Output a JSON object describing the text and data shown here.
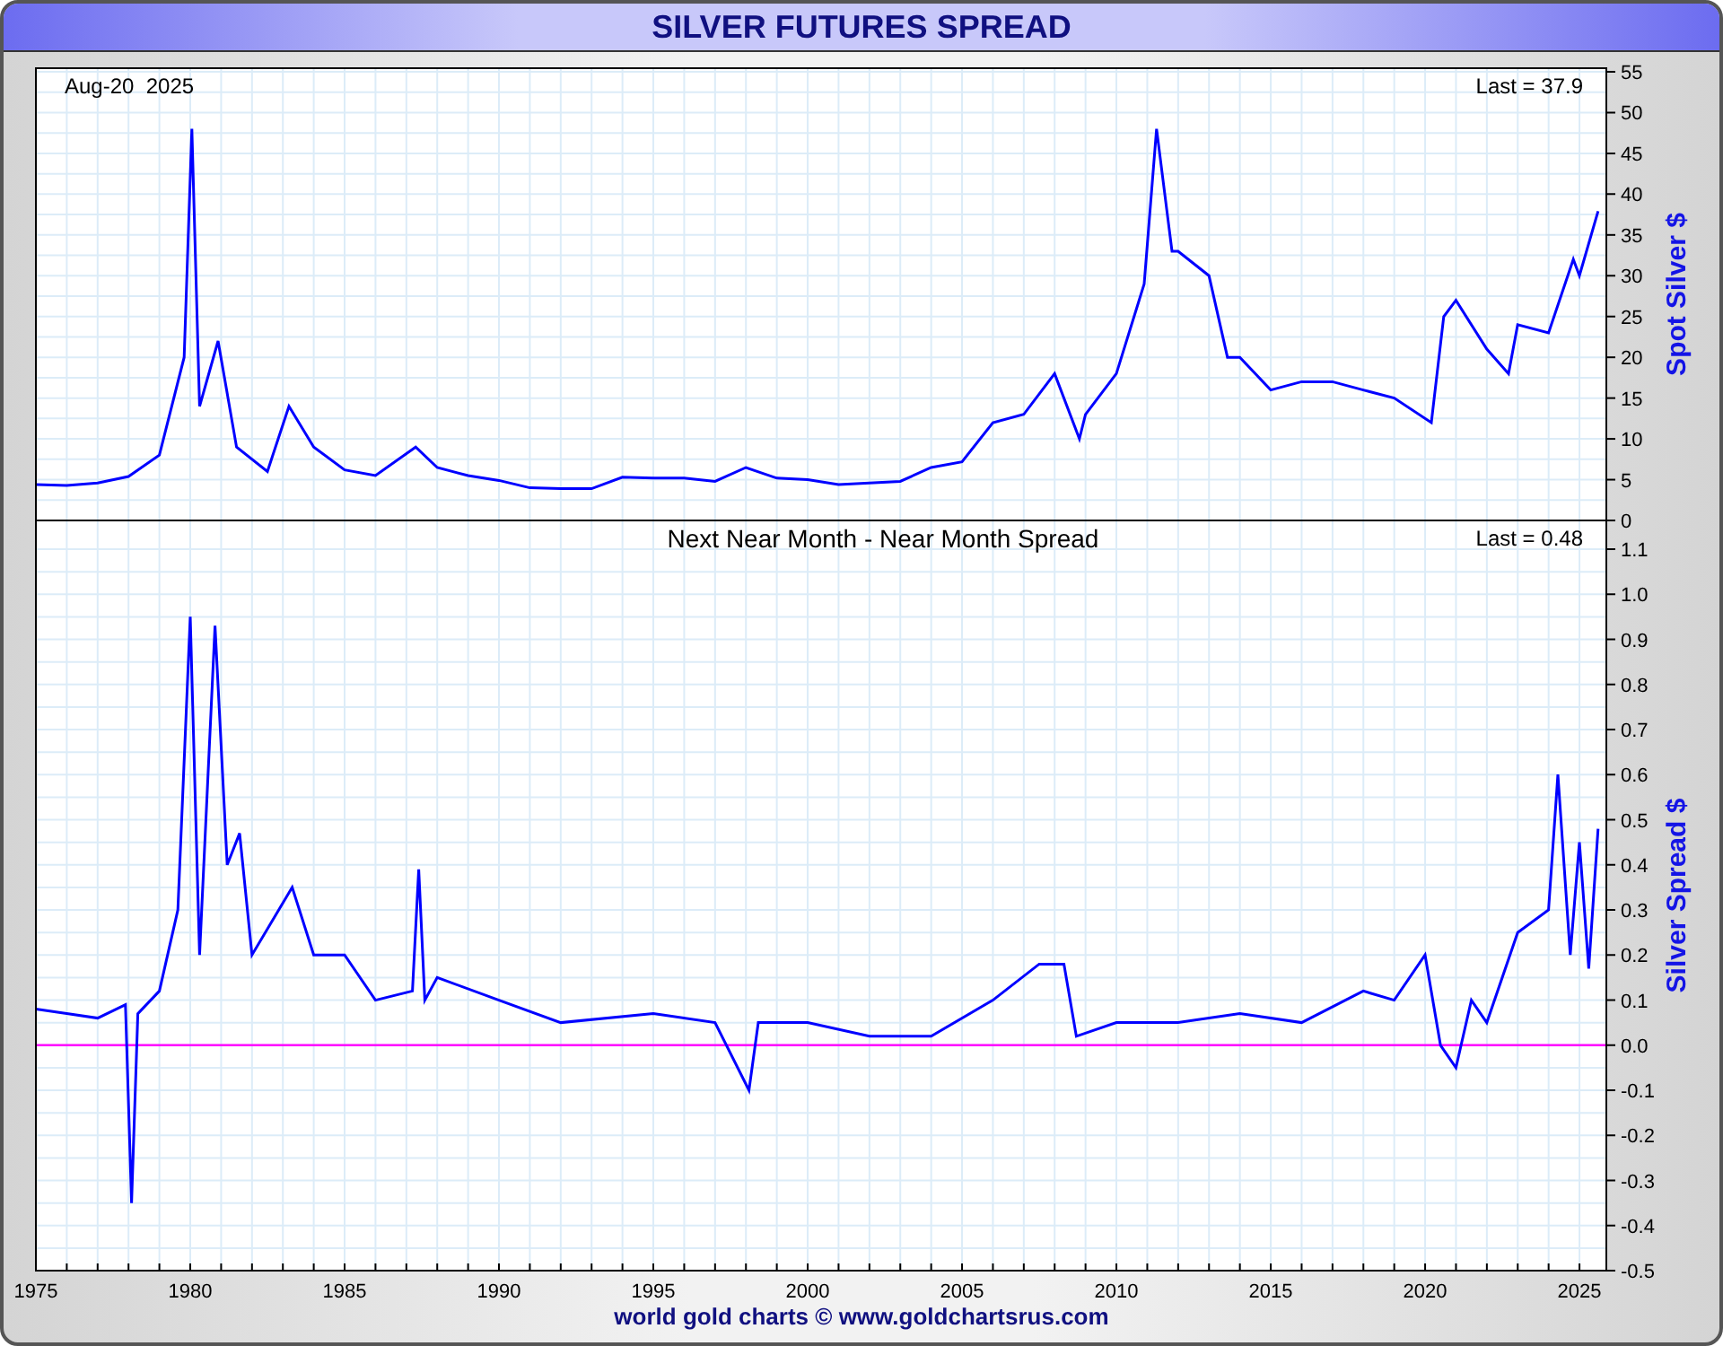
{
  "title": "SILVER FUTURES SPREAD",
  "panels": [
    {
      "date_label": "Aug-20  2025",
      "last": "Last = 37.9",
      "chart_data": {
        "type": "line",
        "grid": true,
        "ylabel": "Spot Silver $",
        "xlim": [
          1975,
          2025.87
        ],
        "ylim": [
          0,
          55
        ],
        "yticks": [
          0,
          5,
          10,
          15,
          20,
          25,
          30,
          35,
          40,
          45,
          50,
          55
        ],
        "x": [
          1975,
          1976,
          1977,
          1978,
          1979,
          1979.8,
          1980.05,
          1980.3,
          1980.9,
          1981.5,
          1982.5,
          1983.2,
          1984,
          1985,
          1986,
          1987.3,
          1988,
          1989,
          1990,
          1991,
          1992,
          1993,
          1994,
          1995,
          1996,
          1997,
          1998,
          1999,
          2000,
          2001,
          2002,
          2003,
          2004,
          2005,
          2006,
          2007,
          2008,
          2008.8,
          2009,
          2010,
          2010.9,
          2011.3,
          2011.8,
          2012,
          2013,
          2013.6,
          2014,
          2015,
          2016,
          2017,
          2018,
          2019,
          2020.2,
          2020.6,
          2021,
          2022,
          2022.7,
          2023,
          2024,
          2024.8,
          2025,
          2025.6
        ],
        "series": [
          {
            "color": "#0000ff",
            "values": [
              4.4,
              4.3,
              4.6,
              5.4,
              8,
              20,
              48,
              14,
              22,
              9,
              6,
              14,
              9,
              6.2,
              5.5,
              9,
              6.5,
              5.5,
              4.9,
              4,
              3.9,
              3.9,
              5.3,
              5.2,
              5.2,
              4.8,
              6.5,
              5.2,
              5,
              4.4,
              4.6,
              4.8,
              6.5,
              7.2,
              12,
              13,
              18,
              10,
              13,
              18,
              29,
              48,
              33,
              33,
              30,
              20,
              20,
              16,
              17,
              17,
              16,
              15,
              12,
              25,
              27,
              21,
              18,
              24,
              23,
              32,
              30,
              37.9
            ]
          }
        ]
      }
    },
    {
      "last": "Last = 0.48",
      "chart_data": {
        "type": "line",
        "grid": true,
        "title": "Next Near Month - Near Month Spread",
        "ylabel": "Silver Spread $",
        "xlim": [
          1975,
          2025.87
        ],
        "ylim": [
          -0.5,
          1.1
        ],
        "xticks": [
          1975,
          1980,
          1985,
          1990,
          1995,
          2000,
          2005,
          2010,
          2015,
          2020,
          2025
        ],
        "yticks": [
          -0.5,
          -0.4,
          -0.3,
          -0.2,
          -0.1,
          {
            "value": 0,
            "label": "0.0"
          },
          0.1,
          0.2,
          0.3,
          0.4,
          0.5,
          0.6,
          0.7,
          0.8,
          0.9,
          {
            "value": 1,
            "label": "1.0"
          },
          1.1
        ],
        "ref_lines": [
          {
            "axis": "y",
            "value": 0,
            "color": "#ff00ff"
          }
        ],
        "x": [
          1975,
          1976,
          1977,
          1977.9,
          1978.1,
          1978.3,
          1979,
          1979.6,
          1980,
          1980.3,
          1980.8,
          1981.2,
          1981.6,
          1982,
          1983.3,
          1984,
          1985,
          1986,
          1987.2,
          1987.4,
          1987.6,
          1988,
          1990,
          1992,
          1995,
          1997,
          1998.1,
          1998.4,
          2000,
          2002,
          2004,
          2006,
          2007.5,
          2008.3,
          2008.7,
          2010,
          2012,
          2014,
          2016,
          2018,
          2019,
          2020,
          2020.5,
          2021,
          2021.5,
          2022,
          2023,
          2024,
          2024.3,
          2024.7,
          2025,
          2025.3,
          2025.6
        ],
        "series": [
          {
            "color": "#0000ff",
            "values": [
              0.08,
              0.07,
              0.06,
              0.09,
              -0.35,
              0.07,
              0.12,
              0.3,
              0.95,
              0.2,
              0.93,
              0.4,
              0.47,
              0.2,
              0.35,
              0.2,
              0.2,
              0.1,
              0.12,
              0.39,
              0.1,
              0.15,
              0.1,
              0.05,
              0.07,
              0.05,
              -0.1,
              0.05,
              0.05,
              0.02,
              0.02,
              0.1,
              0.18,
              0.18,
              0.02,
              0.05,
              0.05,
              0.07,
              0.05,
              0.12,
              0.1,
              0.2,
              0,
              -0.05,
              0.1,
              0.05,
              0.25,
              0.3,
              0.6,
              0.2,
              0.45,
              0.17,
              0.48
            ]
          }
        ]
      }
    }
  ],
  "credit": "world gold charts © www.goldchartsrus.com"
}
